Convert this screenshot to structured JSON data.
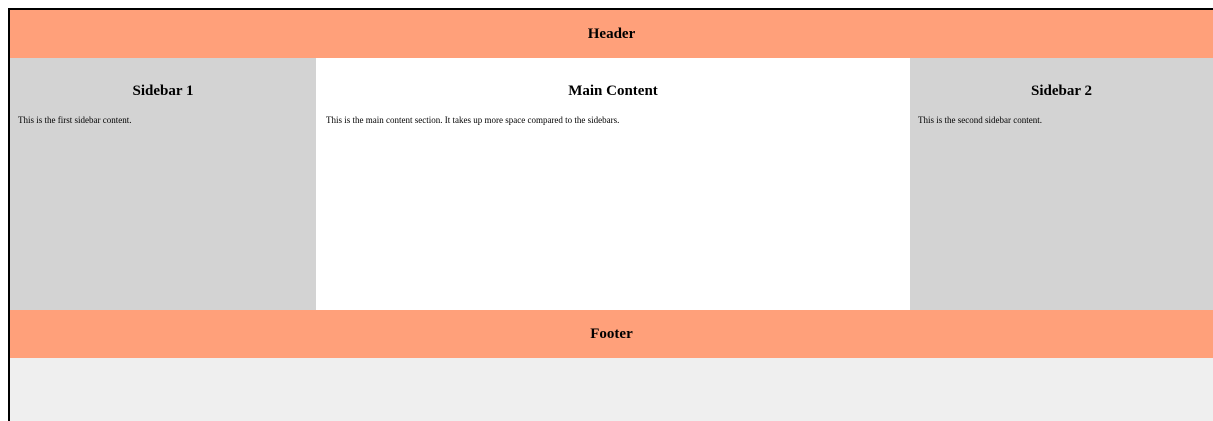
{
  "header": {
    "title": "Header"
  },
  "sidebar1": {
    "title": "Sidebar 1",
    "text": "This is the first sidebar content."
  },
  "main": {
    "title": "Main Content",
    "text": "This is the main content section. It takes up more space compared to the sidebars."
  },
  "sidebar2": {
    "title": "Sidebar 2",
    "text": "This is the second sidebar content."
  },
  "footer": {
    "title": "Footer"
  },
  "colors": {
    "header_footer_bg": "#ffa07a",
    "sidebar_bg": "#d3d3d3",
    "main_bg": "#ffffff",
    "page_bg": "#efefef"
  }
}
